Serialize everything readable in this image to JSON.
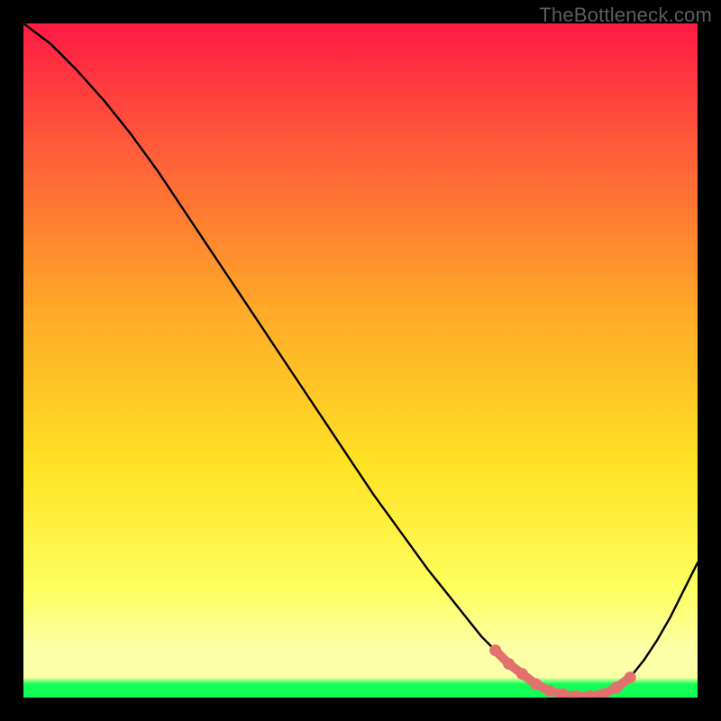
{
  "watermark": "TheBottleneck.com",
  "colors": {
    "background": "#000000",
    "gradient_top": "#ff1a44",
    "gradient_mid_upper": "#ff5a3a",
    "gradient_mid": "#ffa828",
    "gradient_mid_lower": "#ffe324",
    "gradient_low": "#feff60",
    "gradient_paleband": "#fbffa8",
    "gradient_bottom": "#11ff55",
    "curve": "#000000",
    "marker": "#e2716e"
  },
  "chart_data": {
    "type": "line",
    "title": "",
    "xlabel": "",
    "ylabel": "",
    "xlim": [
      0,
      100
    ],
    "ylim": [
      0,
      100
    ],
    "series": [
      {
        "name": "bottleneck-curve",
        "x": [
          0,
          4,
          8,
          12,
          16,
          20,
          24,
          28,
          32,
          36,
          40,
          44,
          48,
          52,
          56,
          60,
          64,
          68,
          70,
          72,
          74,
          76,
          78,
          80,
          82,
          84,
          86,
          88,
          90,
          92,
          94,
          96,
          98,
          100
        ],
        "y": [
          100,
          97,
          93,
          88.5,
          83.5,
          78,
          72,
          66,
          60,
          54,
          48,
          42,
          36,
          30,
          24.5,
          19,
          14,
          9,
          7,
          5,
          3.5,
          2,
          1,
          0.5,
          0.2,
          0.2,
          0.5,
          1.5,
          3,
          5.5,
          8.5,
          12,
          16,
          20
        ]
      }
    ],
    "markers": {
      "name": "optimum-band",
      "x": [
        70,
        72,
        74,
        76,
        78,
        80,
        82,
        84,
        86,
        88,
        90
      ],
      "y": [
        7,
        5,
        3.5,
        2,
        1,
        0.5,
        0.2,
        0.2,
        0.5,
        1.5,
        3
      ]
    }
  }
}
